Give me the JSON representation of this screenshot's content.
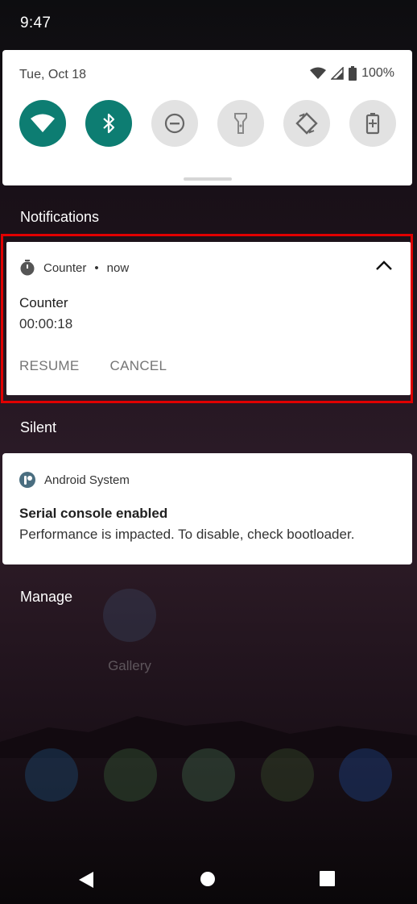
{
  "status_bar": {
    "time": "9:47"
  },
  "quick_settings": {
    "date": "Tue, Oct 18",
    "battery": "100%",
    "tiles": [
      {
        "name": "wifi-icon",
        "state": "on"
      },
      {
        "name": "bluetooth-icon",
        "state": "on"
      },
      {
        "name": "do-not-disturb-icon",
        "state": "off"
      },
      {
        "name": "flashlight-icon",
        "state": "off"
      },
      {
        "name": "auto-rotate-icon",
        "state": "off"
      },
      {
        "name": "battery-saver-icon",
        "state": "off"
      }
    ]
  },
  "notifications_header": "Notifications",
  "counter_notification": {
    "app_name": "Counter",
    "separator": "•",
    "time": "now",
    "title": "Counter",
    "text": "00:00:18",
    "actions": [
      "RESUME",
      "CANCEL"
    ]
  },
  "silent_header": "Silent",
  "system_notification": {
    "app_name": "Android System",
    "title": "Serial console enabled",
    "text": "Performance is impacted. To disable, check bootloader."
  },
  "manage_label": "Manage",
  "home": {
    "gallery_label": "Gallery",
    "dock": [
      "phone-icon",
      "store-icon",
      "maps-icon",
      "android-icon",
      "camera-icon"
    ]
  },
  "colors": {
    "tile_on": "#0d7d72",
    "tile_off": "#e2e2e2",
    "highlight": "#e00000"
  }
}
